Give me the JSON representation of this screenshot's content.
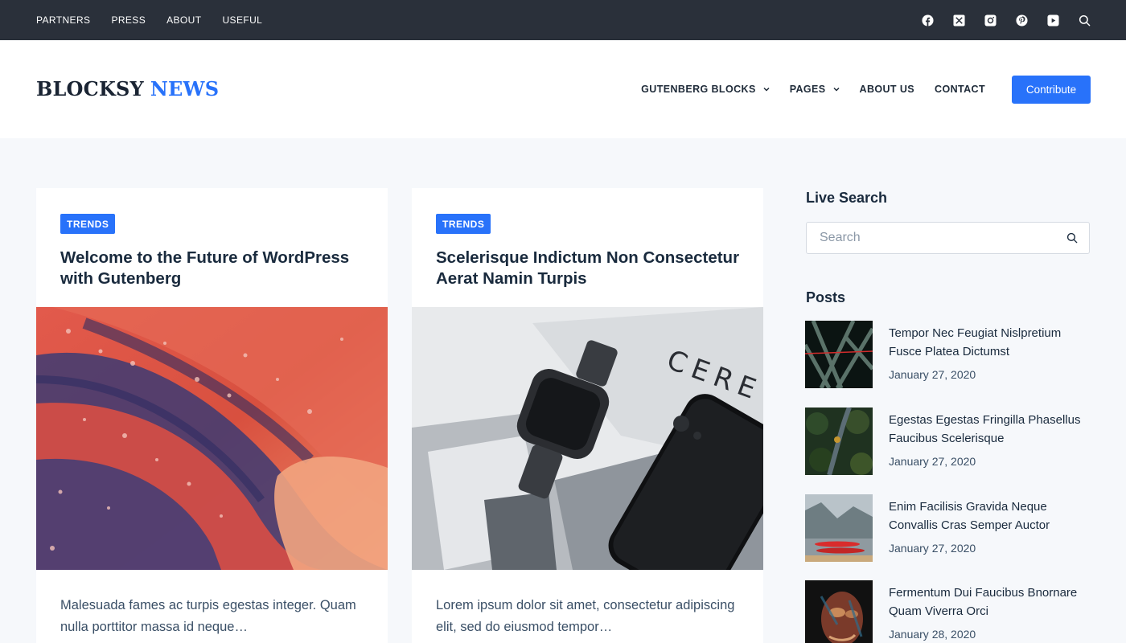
{
  "topbar": {
    "links": [
      "PARTNERS",
      "PRESS",
      "ABOUT",
      "USEFUL"
    ],
    "social_icons": [
      "facebook-icon",
      "x-twitter-icon",
      "instagram-icon",
      "pinterest-icon",
      "youtube-icon",
      "search-icon"
    ]
  },
  "header": {
    "logo_part1": "BLOCKSY",
    "logo_part2": "NEWS",
    "nav": [
      {
        "label": "GUTENBERG BLOCKS",
        "has_dropdown": true
      },
      {
        "label": "PAGES",
        "has_dropdown": true
      },
      {
        "label": "ABOUT US",
        "has_dropdown": false
      },
      {
        "label": "CONTACT",
        "has_dropdown": false
      }
    ],
    "cta_label": "Contribute"
  },
  "cards": [
    {
      "category": "TRENDS",
      "title": "Welcome to the Future of WordPress with Gutenberg",
      "excerpt": "Malesuada fames ac turpis egestas integer. Quam nulla porttitor massa id neque…"
    },
    {
      "category": "TRENDS",
      "title": "Scelerisque Indictum Non Consectetur Aerat Namin Turpis",
      "excerpt": "Lorem ipsum dolor sit amet, consectetur adipiscing elit, sed do eiusmod tempor…"
    }
  ],
  "sidebar": {
    "search_heading": "Live Search",
    "search_placeholder": "Search",
    "posts_heading": "Posts",
    "posts": [
      {
        "title": "Tempor Nec Feugiat Nislpretium Fusce Platea Dictumst",
        "date": "January 27, 2020"
      },
      {
        "title": "Egestas Egestas Fringilla Phasellus Faucibus Scelerisque",
        "date": "January 27, 2020"
      },
      {
        "title": "Enim Facilisis Gravida Neque Convallis Cras Semper Auctor",
        "date": "January 27, 2020"
      },
      {
        "title": "Fermentum Dui Faucibus Bnornare Quam Viverra Orci",
        "date": "January 28, 2020"
      }
    ]
  },
  "colors": {
    "accent": "#2872fa",
    "topbar_bg": "#2a303a",
    "page_bg": "#f6f8fb",
    "heading": "#192a3d"
  }
}
